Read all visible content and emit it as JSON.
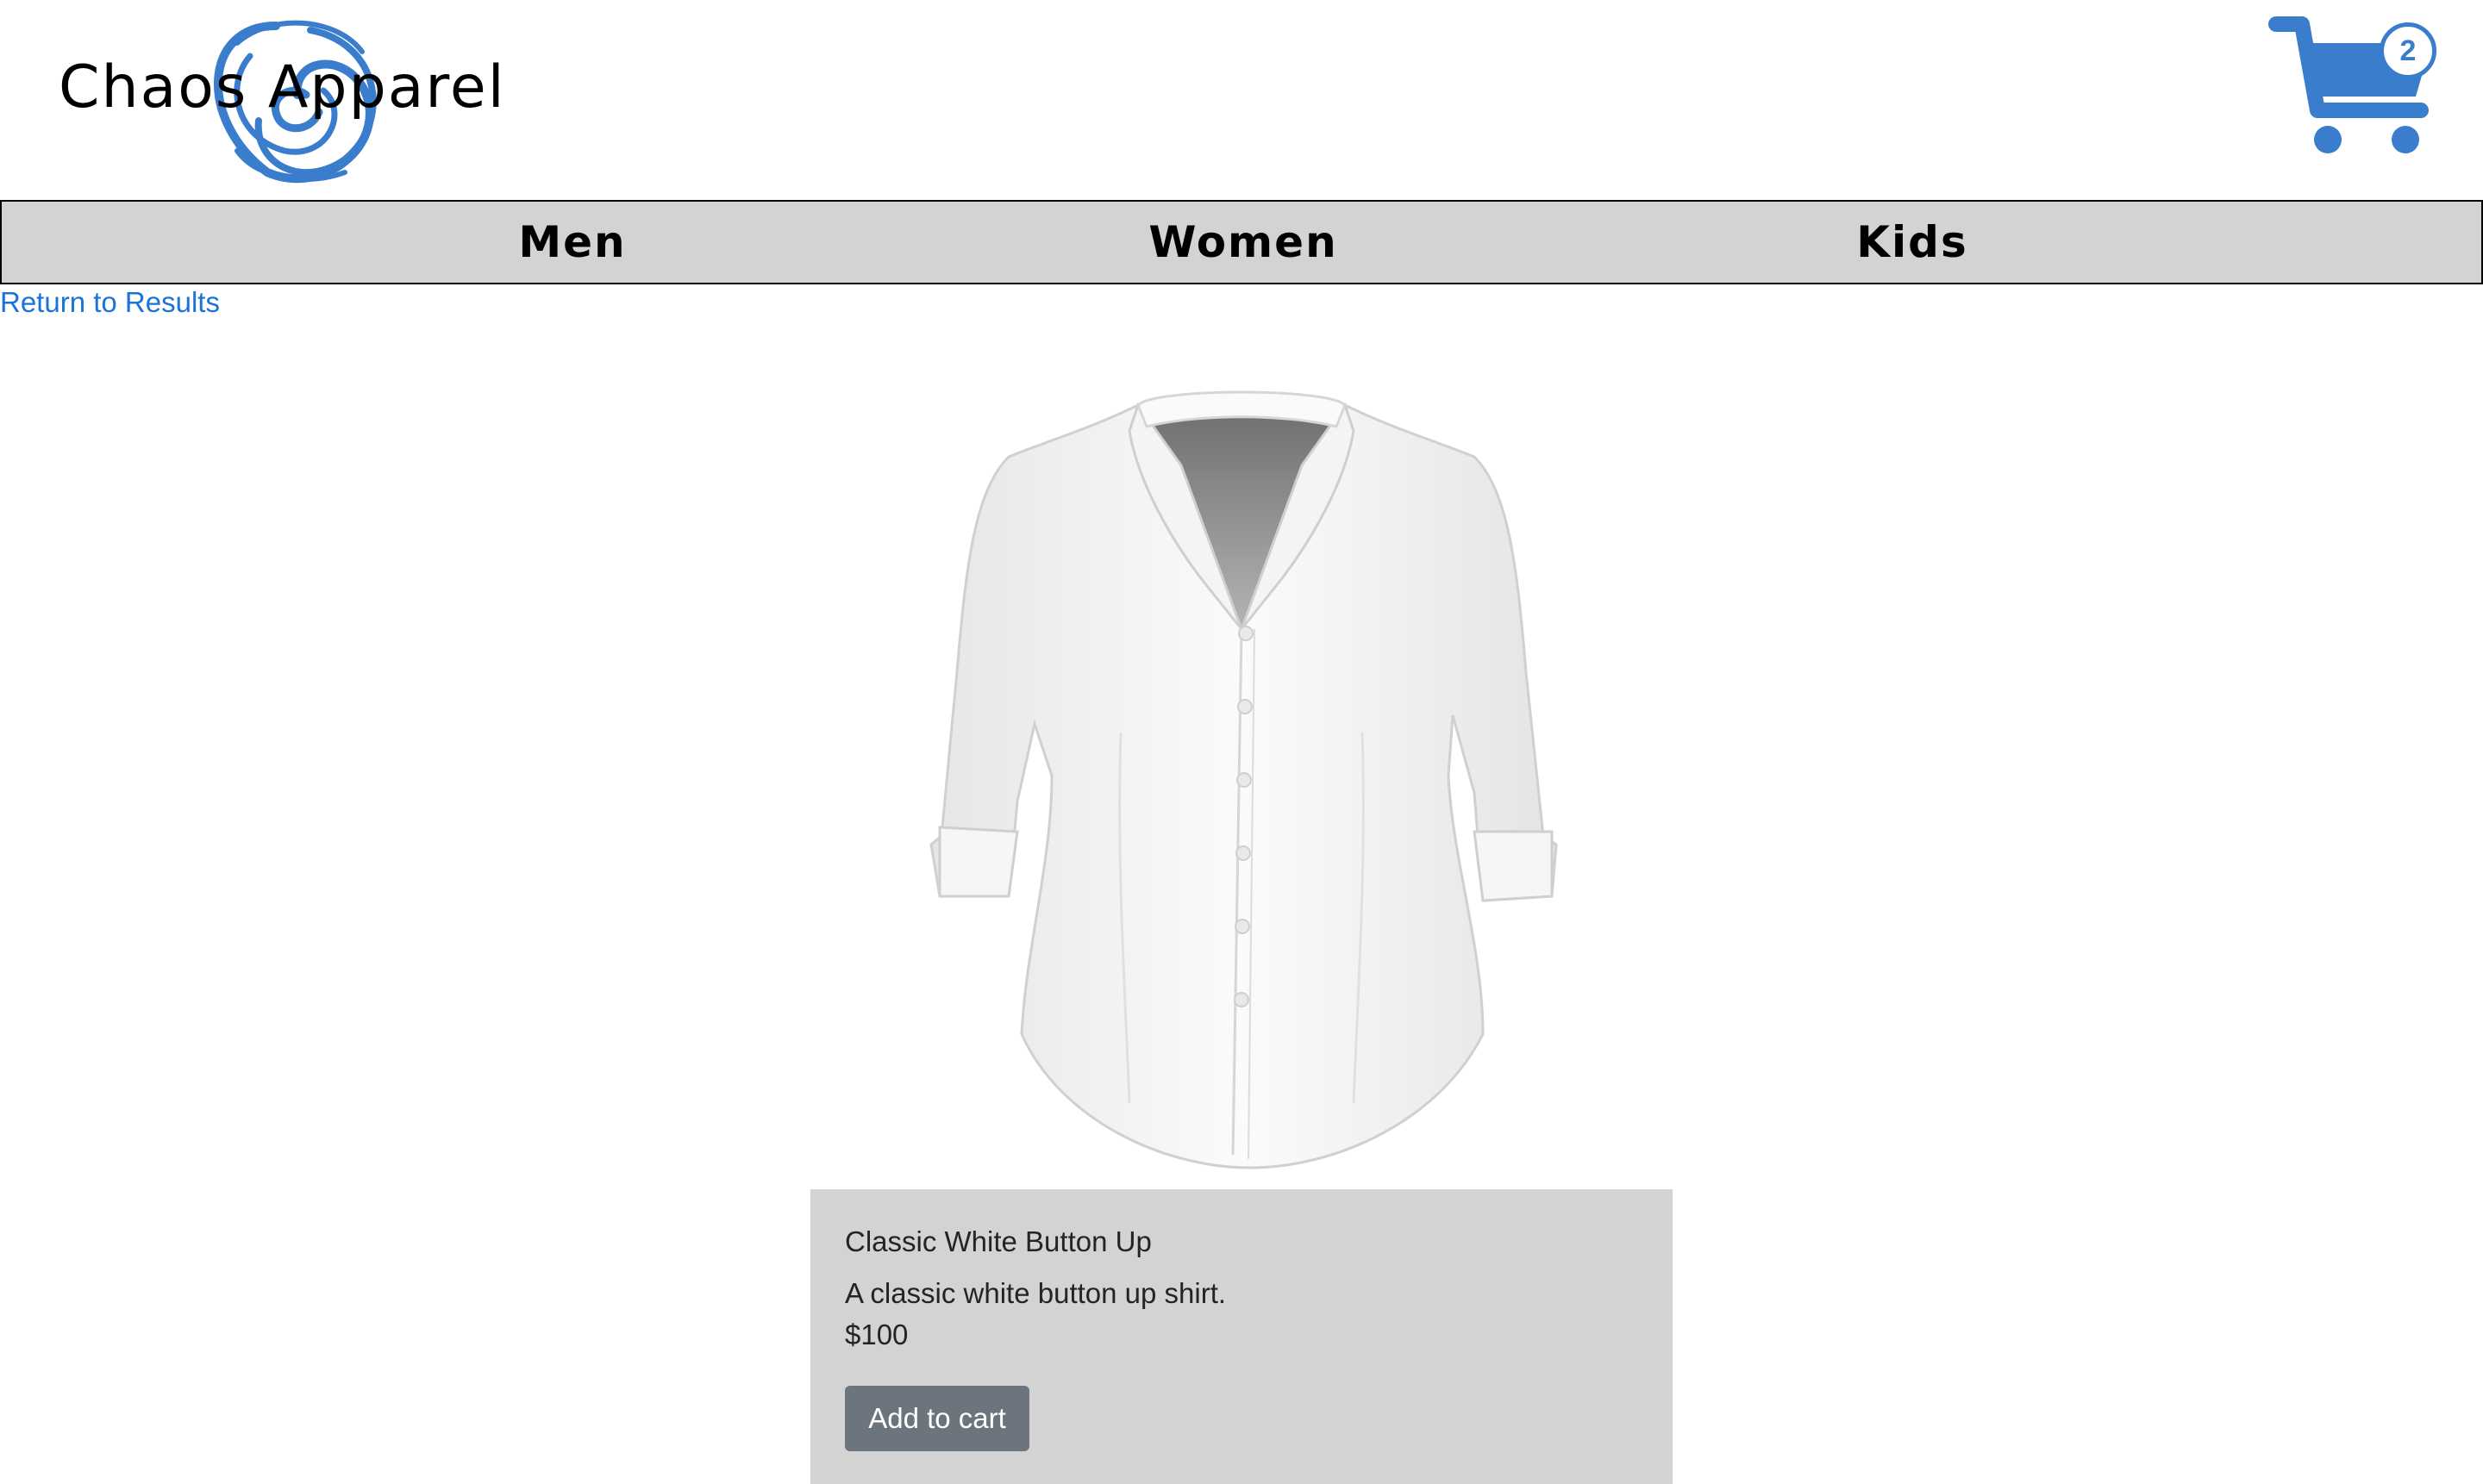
{
  "header": {
    "logo_text": "Chaos Apparel",
    "cart_count": "2",
    "brand_color": "#3a7dcc"
  },
  "nav": {
    "items": [
      {
        "label": "Men"
      },
      {
        "label": "Women"
      },
      {
        "label": "Kids"
      }
    ]
  },
  "return_link": "Return to Results",
  "product": {
    "title": "Classic White Button Up",
    "description": "A classic white button up shirt.",
    "price": "$100",
    "add_to_cart_label": "Add to cart"
  },
  "colors": {
    "nav_bg": "#d3d3d3",
    "link": "#1a73d9",
    "button_bg": "#6c757d",
    "panel_bg": "#d3d3d3"
  }
}
